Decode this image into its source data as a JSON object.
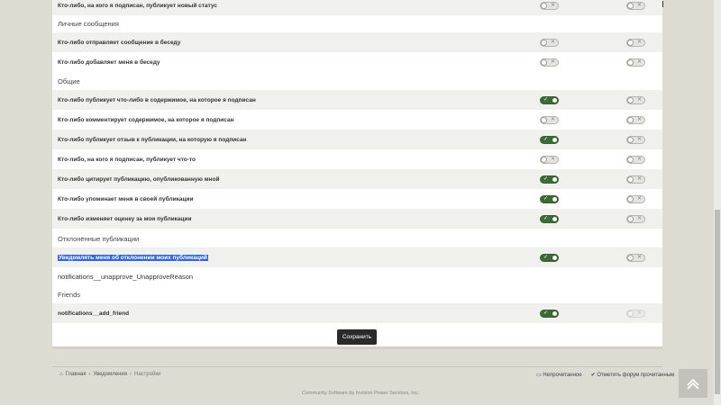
{
  "rows": {
    "r0": {
      "label": "Кто-либо, на кого я подписан, публикует новый статус",
      "c1": "off",
      "c2": "off"
    },
    "s1": "Личные сообщения",
    "r1": {
      "label": "Кто-либо отправляет сообщение в беседу",
      "c1": "off",
      "c2": "off"
    },
    "r2": {
      "label": "Кто-либо добавляет меня в беседу",
      "c1": "off",
      "c2": "off"
    },
    "s2": "Общие",
    "r3": {
      "label": "Кто-либо публикует что-либо в содержимое, на которое я подписан",
      "c1": "on",
      "c2": "off"
    },
    "r4": {
      "label": "Кто-либо комментирует содержимое, на которое я подписан",
      "c1": "off",
      "c2": "off"
    },
    "r5": {
      "label": "Кто-либо публикует отзыв к публикации, на которую я подписан",
      "c1": "on",
      "c2": "off"
    },
    "r6": {
      "label": "Кто-либо, на кого я подписан, публикует что-то",
      "c1": "off",
      "c2": "off"
    },
    "r7": {
      "label": "Кто-либо цитирует публикацию, опубликованную мной",
      "c1": "on",
      "c2": "off"
    },
    "r8": {
      "label": "Кто-либо упоминает меня в своей публикации",
      "c1": "on",
      "c2": "off"
    },
    "r9": {
      "label": "Кто-либо изменяет оценку за мои публикации",
      "c1": "on",
      "c2": "off"
    },
    "s3": "Отклонённые публикации",
    "r10": {
      "label": "Уведомлять меня об отклонении моих публикаций",
      "c1": "on",
      "c2": "off"
    },
    "r11": {
      "label": "notifications__unapprove_UnapproveReason"
    },
    "s4": "Friends",
    "r12": {
      "label": "notifications__add_friend",
      "c1": "on",
      "c2": "disabled"
    }
  },
  "save_label": "Сохранить",
  "breadcrumb": {
    "home": "Главная",
    "notifications": "Уведомления",
    "settings": "Настройки"
  },
  "footer": {
    "unread": "Непрочитанное",
    "mark_read": "Отметить форум прочитанным",
    "copyright": "Community Software by Invision Power Services, Inc."
  },
  "colors": {
    "accent_on": "#3d6a36",
    "background": "#dcdcd3",
    "selection": "#3367d6"
  }
}
